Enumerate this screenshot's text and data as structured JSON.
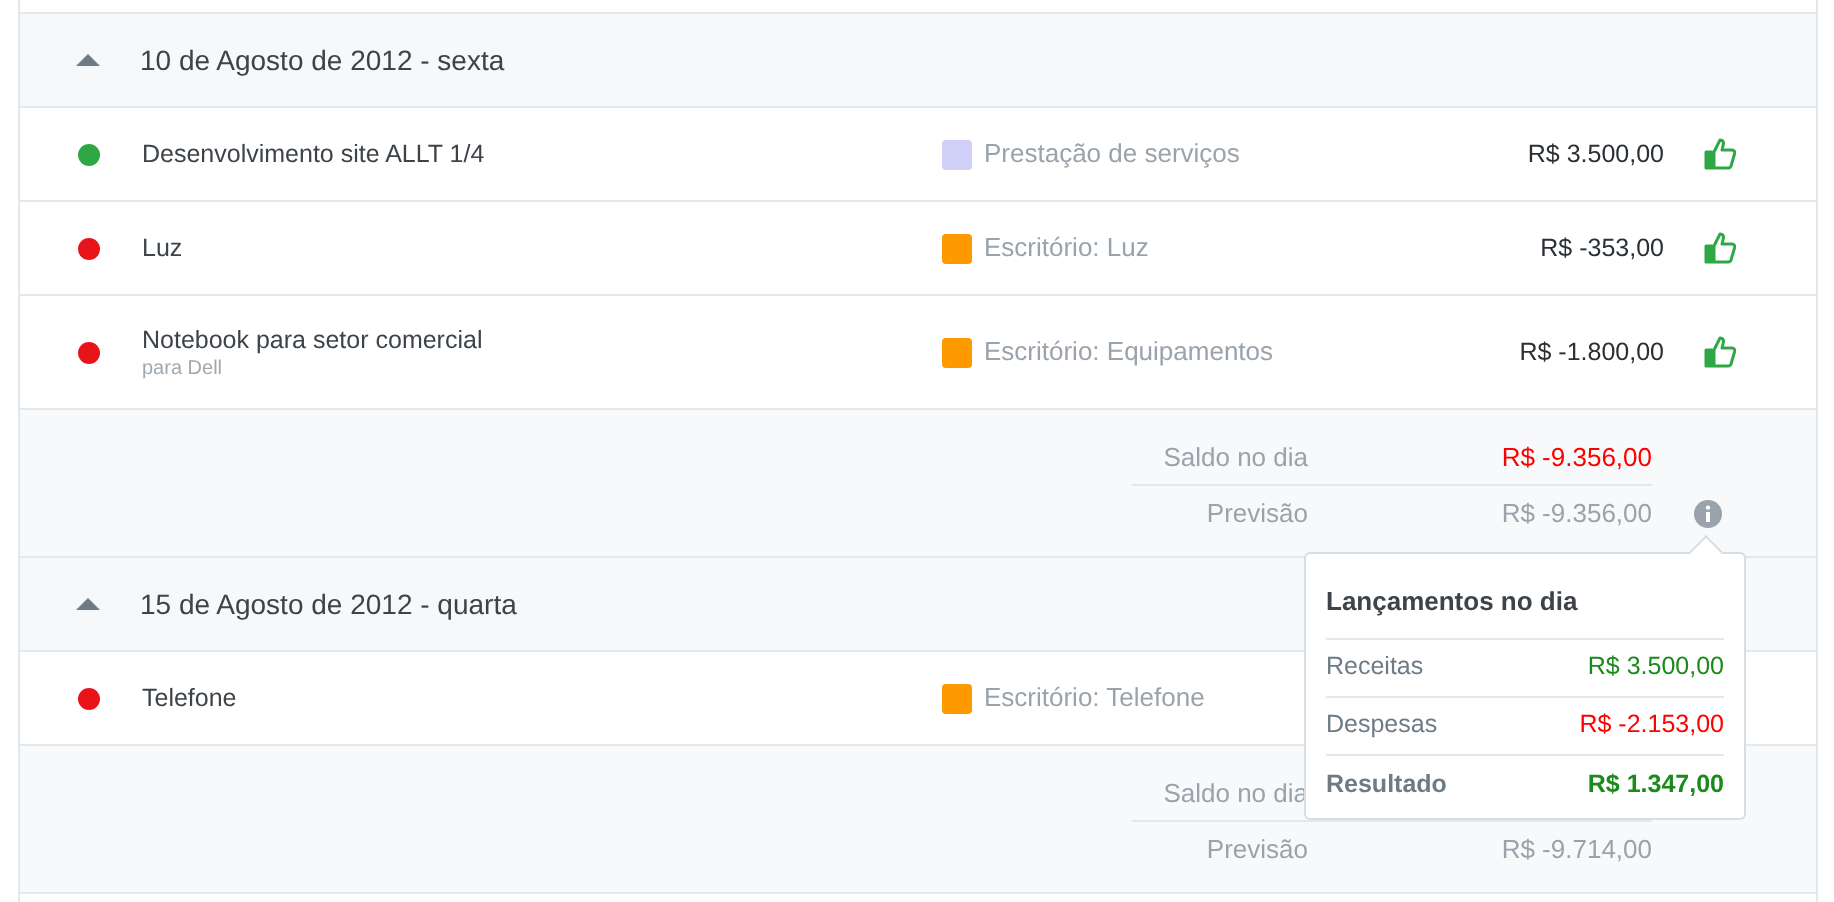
{
  "groups": [
    {
      "date": "10 de Agosto de 2012 - sexta",
      "expanded": true,
      "rows": [
        {
          "color": "#2ea844",
          "title": "Desenvolvimento site ALLT 1/4",
          "category": {
            "label": "Prestação de serviços",
            "color": "#cfcff7"
          },
          "amount": "R$ 3.500,00",
          "confirmed": true
        },
        {
          "color": "#e8141a",
          "title": "Luz",
          "category": {
            "label": "Escritório: Luz",
            "color": "#ff9900"
          },
          "amount": "R$ -353,00",
          "confirmed": true
        },
        {
          "color": "#e8141a",
          "title": "Notebook para setor comercial",
          "subtitle": "para Dell",
          "category": {
            "label": "Escritório: Equipamentos",
            "color": "#ff9900"
          },
          "amount": "R$ -1.800,00",
          "confirmed": true
        }
      ],
      "summary": {
        "balance_label": "Saldo no dia",
        "balance": {
          "text": "R$ -9.356,00",
          "color": "#ff0000"
        },
        "forecast_label": "Previsão",
        "forecast": "R$ -9.356,00",
        "info": true
      }
    },
    {
      "date": "15 de Agosto de 2012 - quarta",
      "expanded": true,
      "rows": [
        {
          "color": "#e8141a",
          "title": "Telefone",
          "category": {
            "label": "Escritório: Telefone",
            "color": "#ff9900"
          }
        }
      ],
      "summary": {
        "balance_label": "Saldo no dia",
        "forecast_label": "Previsão",
        "forecast": "R$ -9.714,00"
      }
    }
  ],
  "popover": {
    "title": "Lançamentos no dia",
    "rows": [
      {
        "kind": "item",
        "label": "Receitas",
        "value": "R$ 3.500,00",
        "color": "#1a8a1a"
      },
      {
        "kind": "item",
        "label": "Despesas",
        "value": "R$ -2.153,00",
        "color": "#ff0000"
      },
      {
        "kind": "total",
        "label": "Resultado",
        "value": "R$ 1.347,00",
        "color": "#1a8a1a"
      }
    ]
  }
}
